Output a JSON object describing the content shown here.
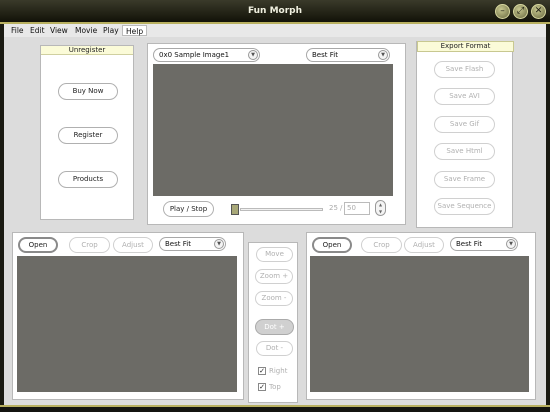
{
  "window": {
    "title": "Fun Morph",
    "buttons": [
      "minimize-icon",
      "maximize-icon",
      "close-icon"
    ]
  },
  "menu": [
    "File",
    "Edit",
    "View",
    "Movie",
    "Play",
    "Help"
  ],
  "registration": {
    "header": "Unregister",
    "buttons": [
      "Buy Now",
      "Register",
      "Products"
    ]
  },
  "preview": {
    "image_select": "0x0 Sample Image1",
    "fit_select": "Best Fit",
    "play_stop": "Play / Stop",
    "frame_current": "25",
    "frame_separator": "/",
    "frame_total": "50"
  },
  "export": {
    "header": "Export Format",
    "buttons": [
      "Save Flash",
      "Save AVI",
      "Save Gif",
      "Save Html",
      "Save Frame",
      "Save Sequence"
    ]
  },
  "left_image": {
    "open": "Open",
    "crop": "Crop",
    "adjust": "Adjust",
    "fit_select": "Best Fit"
  },
  "right_image": {
    "open": "Open",
    "crop": "Crop",
    "adjust": "Adjust",
    "fit_select": "Best Fit"
  },
  "tools": {
    "move": "Move",
    "zoom_in": "Zoom +",
    "zoom_out": "Zoom -",
    "dot_add": "Dot +",
    "dot_remove": "Dot -",
    "right_label": "Right",
    "top_label": "Top"
  },
  "colors": {
    "viewport": "#6c6b66",
    "accent_border": "#b8b060",
    "header_bg": "#fbfbd8"
  }
}
